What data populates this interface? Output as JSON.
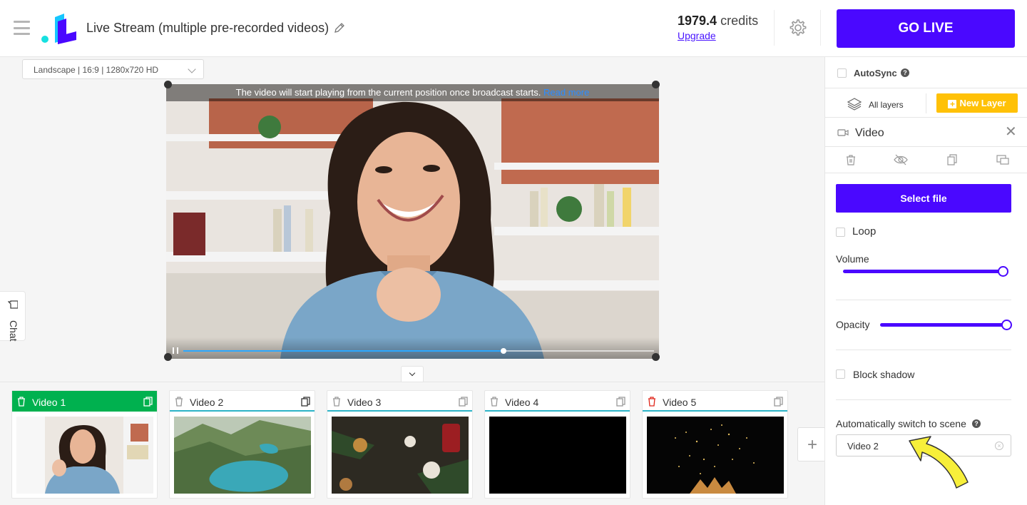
{
  "header": {
    "title": "Live Stream (multiple pre-recorded videos)",
    "credits_value": "1979.4",
    "credits_unit": "credits",
    "upgrade_label": "Upgrade",
    "go_live_label": "GO LIVE",
    "brand_color": "#4a08ff"
  },
  "stage": {
    "resolution_select": "Landscape | 16:9 | 1280x720 HD",
    "notice_text": "The video will start playing from the current position once broadcast starts.",
    "read_more_label": "Read more",
    "playback_progress": 0.68
  },
  "chat": {
    "label": "Chat"
  },
  "scenes": [
    {
      "name": "Video 1",
      "active": true
    },
    {
      "name": "Video 2",
      "active": false
    },
    {
      "name": "Video 3",
      "active": false
    },
    {
      "name": "Video 4",
      "active": false
    },
    {
      "name": "Video 5",
      "active": false
    }
  ],
  "panel": {
    "autosync_label": "AutoSync",
    "autosync_checked": false,
    "all_layers_label": "All layers",
    "new_layer_label": "New Layer",
    "layer_title": "Video",
    "select_file_label": "Select file",
    "loop_label": "Loop",
    "loop_checked": false,
    "volume_label": "Volume",
    "volume_value": 1.0,
    "opacity_label": "Opacity",
    "opacity_value": 1.0,
    "block_shadow_label": "Block shadow",
    "block_shadow_checked": false,
    "auto_switch_label": "Automatically switch to scene",
    "auto_switch_value": "Video 2"
  },
  "colors": {
    "accent": "#4a08ff",
    "active_scene": "#00b14f",
    "new_layer": "#ffc107",
    "link": "#4a16ff",
    "annotation_arrow": "#f7ef3a"
  }
}
